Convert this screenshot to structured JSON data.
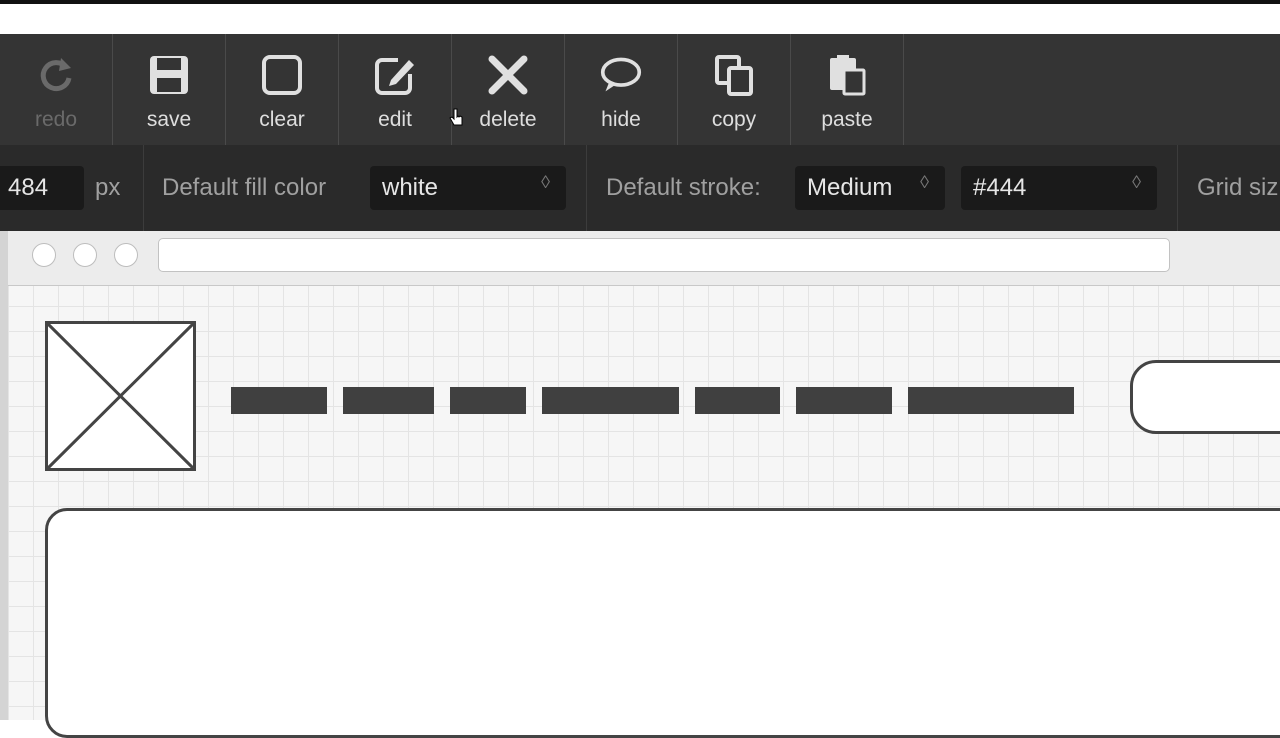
{
  "toolbar": {
    "items": [
      {
        "label": "redo",
        "icon": "redo-icon",
        "enabled": false
      },
      {
        "label": "save",
        "icon": "save-icon",
        "enabled": true
      },
      {
        "label": "clear",
        "icon": "clear-icon",
        "enabled": true
      },
      {
        "label": "edit",
        "icon": "edit-icon",
        "enabled": true
      },
      {
        "label": "delete",
        "icon": "delete-icon",
        "enabled": true
      },
      {
        "label": "hide",
        "icon": "hide-icon",
        "enabled": true
      },
      {
        "label": "copy",
        "icon": "copy-icon",
        "enabled": true
      },
      {
        "label": "paste",
        "icon": "paste-icon",
        "enabled": true
      }
    ]
  },
  "options": {
    "width_value": "484",
    "width_unit": "px",
    "fill_label": "Default fill color",
    "fill_value": "white",
    "stroke_label": "Default stroke:",
    "stroke_value": "Medium",
    "stroke_color": "#444",
    "grid_label": "Grid siz"
  },
  "colors": {
    "toolbar_bg": "#343434",
    "optbar_bg": "#2a2a2a",
    "shape_stroke": "#444444"
  }
}
